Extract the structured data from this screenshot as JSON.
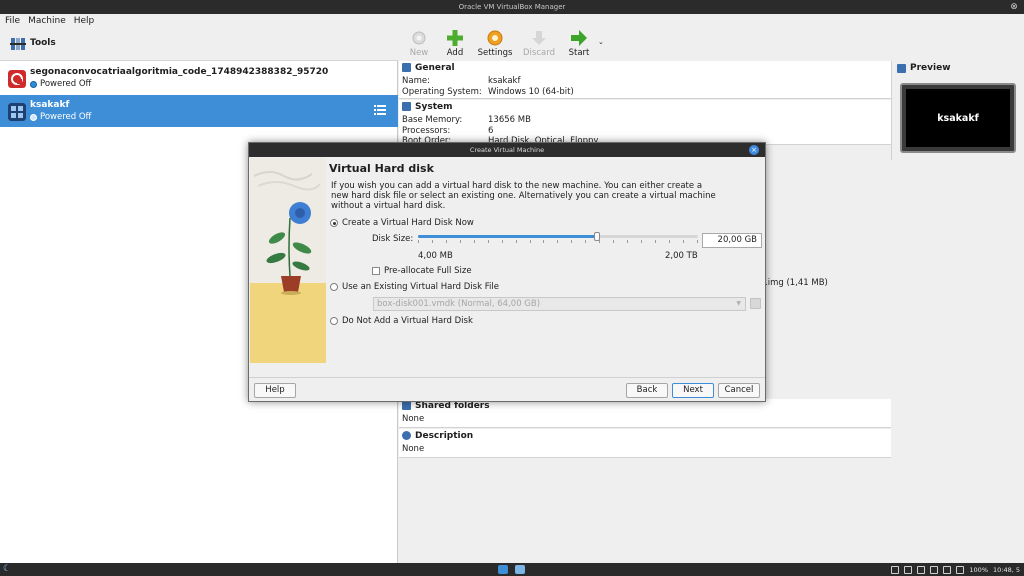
{
  "window": {
    "title": "Oracle VM VirtualBox Manager"
  },
  "menu": [
    {
      "label": "File"
    },
    {
      "label": "Machine"
    },
    {
      "label": "Help"
    }
  ],
  "sidebar": {
    "tools_label": "Tools",
    "vms": [
      {
        "name": "segonaconvocatriaalgoritmia_code_1748942388382_95720",
        "state": "Powered Off"
      },
      {
        "name": "ksakakf",
        "state": "Powered Off"
      }
    ]
  },
  "toolbar": {
    "new_label": "New",
    "add_label": "Add",
    "settings_label": "Settings",
    "discard_label": "Discard",
    "start_label": "Start"
  },
  "details": {
    "general": {
      "title": "General",
      "name_key": "Name:",
      "name_val": "ksakakf",
      "os_key": "Operating System:",
      "os_val": "Windows 10 (64-bit)"
    },
    "system": {
      "title": "System",
      "mem_key": "Base Memory:",
      "mem_val": "13656 MB",
      "proc_key": "Processors:",
      "proc_val": "6",
      "boot_key": "Boot Order:",
      "boot_val": "Hard Disk, Optical, Floppy"
    },
    "storage_peek": ".img (1,41 MB)",
    "shared": {
      "title": "Shared folders",
      "value": "None"
    },
    "description": {
      "title": "Description",
      "value": "None"
    },
    "preview": {
      "title": "Preview",
      "screen_text": "ksakakf"
    }
  },
  "dialog": {
    "title": "Create Virtual Machine",
    "heading": "Virtual Hard disk",
    "description": "If you wish you can add a virtual hard disk to the new machine. You can either create a new hard disk file or select an existing one. Alternatively you can create a virtual machine without a virtual hard disk.",
    "option_create": "Create a Virtual Hard Disk Now",
    "disk_size_label": "Disk Size:",
    "disk_size_value": "20,00 GB",
    "slider_fraction": 0.64,
    "slider_min": "4,00 MB",
    "slider_max": "2,00 TB",
    "preallocate_label": "Pre-allocate Full Size",
    "option_existing": "Use an Existing Virtual Hard Disk File",
    "existing_file": "box-disk001.vmdk (Normal, 64,00 GB)",
    "option_none": "Do Not Add a Virtual Hard Disk",
    "help_label": "Help",
    "back_label": "Back",
    "next_label": "Next",
    "cancel_label": "Cancel"
  },
  "taskbar": {
    "battery": "100%",
    "clock": "10:48, 5"
  },
  "colors": {
    "accent": "#3d8ed6",
    "selection": "#3d8ed6",
    "titlebar": "#2b2b2b"
  }
}
